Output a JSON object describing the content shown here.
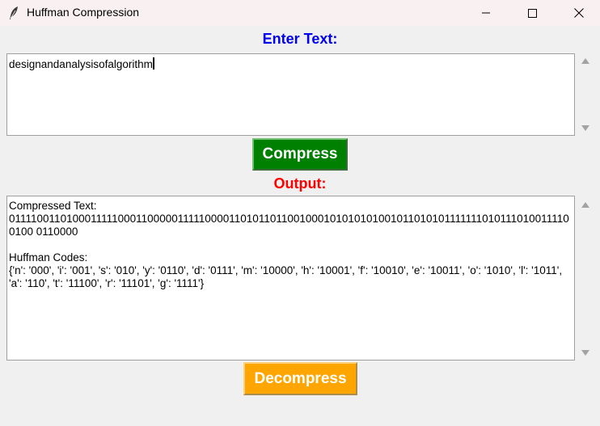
{
  "window": {
    "title": "Huffman Compression"
  },
  "input": {
    "label": "Enter Text:",
    "value": "designandanalysisofalgorithm"
  },
  "buttons": {
    "compress": "Compress",
    "decompress": "Decompress"
  },
  "output": {
    "label": "Output:",
    "text": "Compressed Text:\n0111100110100011111000110000011111000011010110110010001010101010010110101011111110101110100111100100 0110000\n\nHuffman Codes:\n{'n': '000', 'i': '001', 's': '010', 'y': '0110', 'd': '0111', 'm': '10000', 'h': '10001', 'f': '10010', 'e': '10011', 'o': '1010', 'l': '1011', 'a': '110', 't': '11100', 'r': '11101', 'g': '1111'}"
  },
  "colors": {
    "enter_label": "#0000ee",
    "output_label": "#ff0000",
    "compress_bg": "#008000",
    "decompress_bg": "#ffa500"
  }
}
